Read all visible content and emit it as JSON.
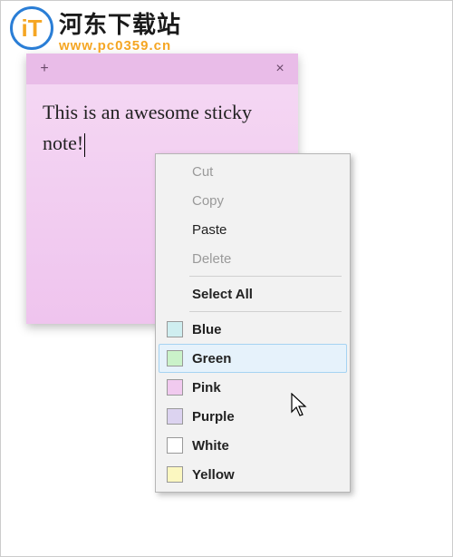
{
  "watermark": {
    "logo_text": "iT",
    "title": "河东下载站",
    "url": "www.pc0359.cn"
  },
  "note": {
    "text": "This is an awesome sticky note!",
    "add_label": "+",
    "close_label": "×"
  },
  "menu": {
    "cut": "Cut",
    "copy": "Copy",
    "paste": "Paste",
    "delete": "Delete",
    "select_all": "Select All",
    "colors": [
      {
        "label": "Blue",
        "swatch": "#cfeef0",
        "hover": false
      },
      {
        "label": "Green",
        "swatch": "#caf2c9",
        "hover": true
      },
      {
        "label": "Pink",
        "swatch": "#f1caef",
        "hover": false
      },
      {
        "label": "Purple",
        "swatch": "#dcd3f0",
        "hover": false
      },
      {
        "label": "White",
        "swatch": "#ffffff",
        "hover": false
      },
      {
        "label": "Yellow",
        "swatch": "#fbf7c0",
        "hover": false
      }
    ]
  }
}
